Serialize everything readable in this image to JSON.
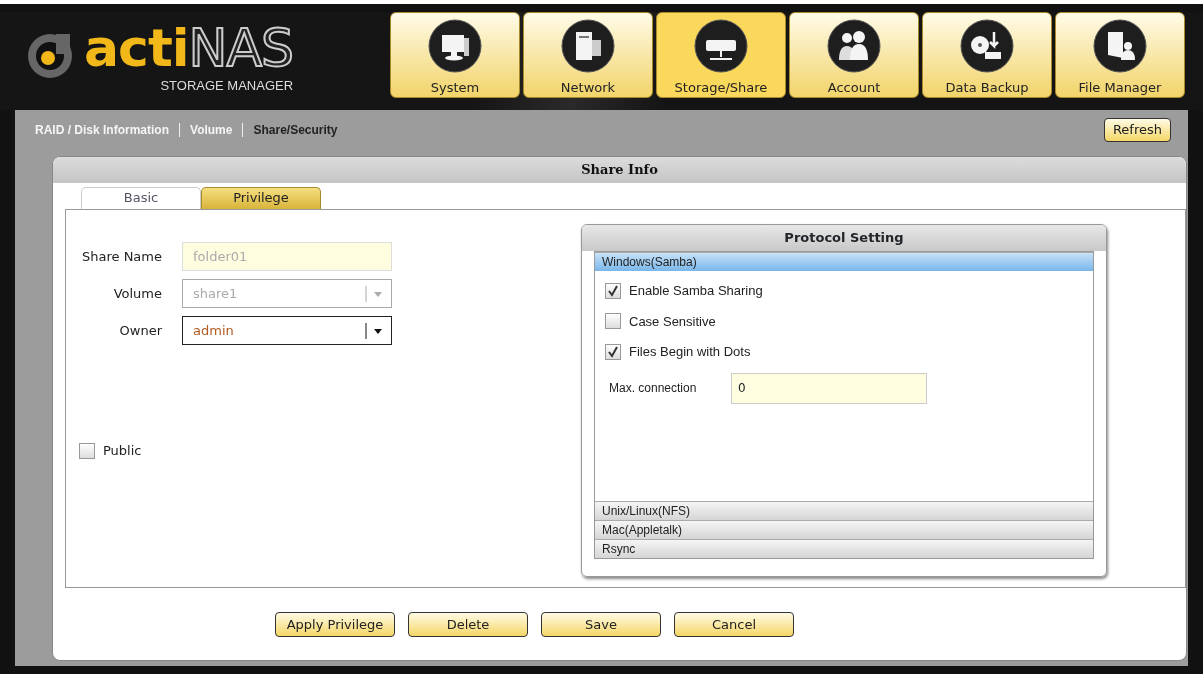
{
  "logo": {
    "accent": "acti",
    "main": "NAS",
    "subtitle": "STORAGE MANAGER"
  },
  "nav": [
    {
      "label": "System",
      "selected": false
    },
    {
      "label": "Network",
      "selected": false
    },
    {
      "label": "Storage/Share",
      "selected": true
    },
    {
      "label": "Account",
      "selected": false
    },
    {
      "label": "Data Backup",
      "selected": false
    },
    {
      "label": "File Manager",
      "selected": false
    }
  ],
  "subnav": [
    {
      "label": "RAID / Disk Information",
      "selected": false
    },
    {
      "label": "Volume",
      "selected": false
    },
    {
      "label": "Share/Security",
      "selected": true
    }
  ],
  "refresh_button": "Refresh",
  "panel": {
    "title": "Share Info",
    "tabs": [
      {
        "label": "Basic",
        "selected": true
      },
      {
        "label": "Privilege",
        "selected": false
      }
    ],
    "fields": [
      {
        "label": "Share Name",
        "kind": "text",
        "value": "folder01",
        "disabled": true
      },
      {
        "label": "Volume",
        "kind": "select",
        "value": "share1",
        "disabled": true
      },
      {
        "label": "Owner",
        "kind": "select",
        "value": "admin",
        "disabled": false
      }
    ],
    "public": {
      "label": "Public",
      "checked": false
    },
    "protocol": {
      "title": "Protocol Setting",
      "sections": [
        {
          "label": "Windows(Samba)",
          "expanded": true,
          "options": [
            {
              "label": "Enable Samba Sharing",
              "checked": true
            },
            {
              "label": "Case Sensitive",
              "checked": false
            },
            {
              "label": "Files Begin with Dots",
              "checked": true
            }
          ],
          "max_connection": {
            "label": "Max. connection",
            "value": "0"
          }
        },
        {
          "label": "Unix/Linux(NFS)",
          "expanded": false
        },
        {
          "label": "Mac(Appletalk)",
          "expanded": false
        },
        {
          "label": "Rsync",
          "expanded": false
        }
      ]
    },
    "buttons": [
      "Apply Privilege",
      "Delete",
      "Save",
      "Cancel"
    ]
  }
}
